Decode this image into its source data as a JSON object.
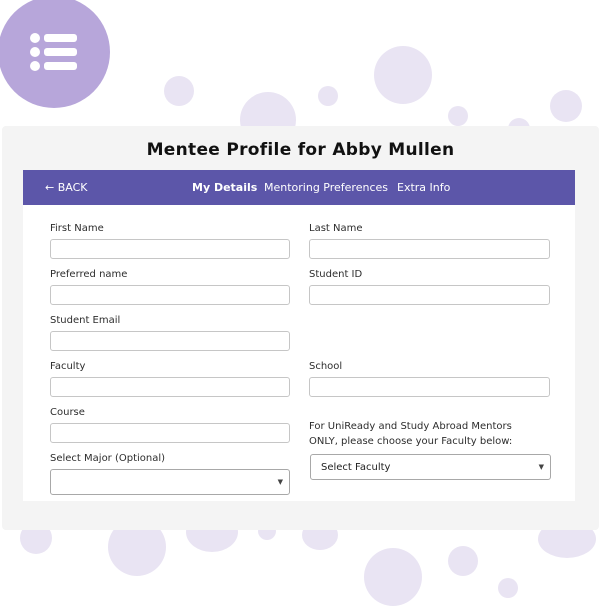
{
  "page": {
    "title": "Mentee Profile for Abby Mullen"
  },
  "nav": {
    "back": "← BACK",
    "tabs": [
      {
        "label": "My Details",
        "active": true
      },
      {
        "label": "Mentoring Preferences",
        "active": false
      },
      {
        "label": "Extra Info",
        "active": false
      }
    ]
  },
  "form": {
    "first_name": {
      "label": "First Name",
      "value": ""
    },
    "last_name": {
      "label": "Last Name",
      "value": ""
    },
    "preferred_name": {
      "label": "Preferred name",
      "value": ""
    },
    "student_id": {
      "label": "Student ID",
      "value": ""
    },
    "student_email": {
      "label": "Student Email",
      "value": ""
    },
    "faculty": {
      "label": "Faculty",
      "value": ""
    },
    "school": {
      "label": "School",
      "value": ""
    },
    "course": {
      "label": "Course",
      "value": ""
    },
    "major": {
      "label": "Select Major (Optional)",
      "selected": ""
    },
    "unready_faculty": {
      "label_line1": "For UniReady and Study Abroad Mentors",
      "label_line2": "ONLY, please choose your Faculty below:",
      "selected": "Select Faculty"
    }
  },
  "colors": {
    "nav_bar": "#5c56a9",
    "menu_circle": "#b7a6da",
    "bubbles": "#e9e4f3"
  },
  "icons": {
    "menu": "list-menu-icon",
    "dropdown": "caret-down-icon"
  }
}
